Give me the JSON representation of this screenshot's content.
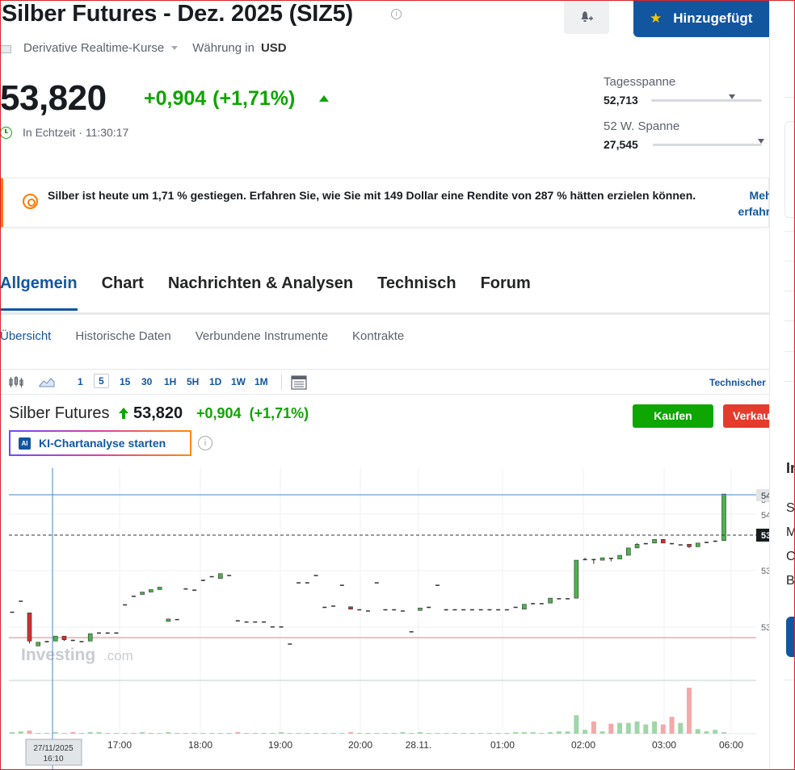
{
  "header": {
    "title": "Silber Futures - Dez. 2025 (SIZ5)",
    "added_label": "Hinzugefügt",
    "source_label": "Derivative Realtime-Kurse",
    "currency_label": "Währung in",
    "currency_value": "USD"
  },
  "quote": {
    "price": "53,820",
    "change": "+0,904",
    "change_pct": "(+1,71%)",
    "realtime_label": "In Echtzeit",
    "time": "11:30:17",
    "day_range_label": "Tagesspanne",
    "day_range_low": "52,713",
    "week52_range_label": "52 W. Spanne",
    "week52_low": "27,545"
  },
  "banner": {
    "text": "Silber ist heute um 1,71 % gestiegen. Erfahren Sie, wie Sie mit 149 Dollar eine Rendite von 287 % hätten erzielen können.",
    "link_line1": "Mehr",
    "link_line2": "erfahre"
  },
  "tabs": [
    "Allgemein",
    "Chart",
    "Nachrichten & Analysen",
    "Technisch",
    "Forum"
  ],
  "subtabs": [
    "Übersicht",
    "Historische Daten",
    "Verbundene Instrumente",
    "Kontrakte"
  ],
  "toolbar": {
    "timeframes": [
      "1",
      "5",
      "15",
      "30",
      "1H",
      "5H",
      "1D",
      "1W",
      "1M"
    ],
    "selected": "5",
    "tech_link": "Technischer"
  },
  "chart_header": {
    "name": "Silber Futures",
    "price": "53,820",
    "change": "+0,904",
    "change_pct": "(+1,71%)",
    "buy_label": "Kaufen",
    "sell_label": "Verkau",
    "ai_label": "KI-Chartanalyse starten",
    "ai_badge": "AI"
  },
  "chart_data": {
    "type": "candlestick",
    "watermark": "Investing",
    "watermark_suffix": ".com",
    "x_tick_labels": [
      "17:00",
      "18:00",
      "19:00",
      "20:00",
      "28.11.",
      "01:00",
      "02:00",
      "03:00",
      "06:00"
    ],
    "crosshair_label_date": "27/11/2025",
    "crosshair_label_time": "16:10",
    "y_tick_labels": [
      "54",
      "54",
      "53",
      "53",
      "53"
    ],
    "last_price_label": "53",
    "candles": [
      [
        52.86,
        52.86,
        52.86,
        52.86
      ],
      [
        52.95,
        52.95,
        52.95,
        52.95
      ],
      [
        52.85,
        52.62,
        52.85,
        52.6
      ],
      [
        52.58,
        52.61,
        52.61,
        52.58
      ],
      [
        52.61,
        52.62,
        52.62,
        52.61
      ],
      [
        52.62,
        52.66,
        52.66,
        52.62
      ],
      [
        52.66,
        52.63,
        52.66,
        52.62
      ],
      [
        52.63,
        52.62,
        52.63,
        52.62
      ],
      [
        52.62,
        52.62,
        52.62,
        52.62
      ],
      [
        52.62,
        52.68,
        52.68,
        52.62
      ],
      [
        52.68,
        52.69,
        52.69,
        52.68
      ],
      [
        52.69,
        52.68,
        52.69,
        52.68
      ],
      [
        52.68,
        52.69,
        52.69,
        52.68
      ],
      [
        52.92,
        52.92,
        52.92,
        52.92
      ],
      [
        52.99,
        52.99,
        52.99,
        52.99
      ],
      [
        53.0,
        53.02,
        53.02,
        53.0
      ],
      [
        53.02,
        53.04,
        53.04,
        53.02
      ],
      [
        53.04,
        53.06,
        53.06,
        53.04
      ],
      [
        52.78,
        52.8,
        52.8,
        52.78
      ],
      [
        52.8,
        52.8,
        52.8,
        52.8
      ],
      [
        53.05,
        53.04,
        53.05,
        53.04
      ],
      [
        53.04,
        53.04,
        53.04,
        53.04
      ],
      [
        53.11,
        53.12,
        53.12,
        53.11
      ],
      [
        53.15,
        53.15,
        53.15,
        53.15
      ],
      [
        53.13,
        53.17,
        53.17,
        53.13
      ],
      [
        53.16,
        53.16,
        53.16,
        53.16
      ],
      [
        52.79,
        52.78,
        52.79,
        52.78
      ],
      [
        52.78,
        52.78,
        52.78,
        52.78
      ],
      [
        52.78,
        52.78,
        52.78,
        52.78
      ],
      [
        52.78,
        52.78,
        52.78,
        52.78
      ],
      [
        52.74,
        52.74,
        52.74,
        52.74
      ],
      [
        52.74,
        52.74,
        52.74,
        52.74
      ],
      [
        52.6,
        52.6,
        52.6,
        52.6
      ],
      [
        53.1,
        53.1,
        53.1,
        53.1
      ],
      [
        53.1,
        53.1,
        53.1,
        53.1
      ],
      [
        53.16,
        53.16,
        53.16,
        53.16
      ],
      [
        52.9,
        52.9,
        52.9,
        52.9
      ],
      [
        52.91,
        52.91,
        52.91,
        52.91
      ],
      [
        53.08,
        53.08,
        53.08,
        53.08
      ],
      [
        52.9,
        52.88,
        52.9,
        52.88
      ],
      [
        52.88,
        52.88,
        52.88,
        52.88
      ],
      [
        52.87,
        52.87,
        52.87,
        52.87
      ],
      [
        53.1,
        53.1,
        53.1,
        53.1
      ],
      [
        52.88,
        52.88,
        52.88,
        52.88
      ],
      [
        52.88,
        52.88,
        52.88,
        52.88
      ],
      [
        52.87,
        52.87,
        52.87,
        52.87
      ],
      [
        52.7,
        52.7,
        52.7,
        52.7
      ],
      [
        52.87,
        52.89,
        52.89,
        52.87
      ],
      [
        52.89,
        52.9,
        52.9,
        52.89
      ],
      [
        53.08,
        53.08,
        53.08,
        53.08
      ],
      [
        52.87,
        52.88,
        52.88,
        52.87
      ],
      [
        52.88,
        52.88,
        52.88,
        52.88
      ],
      [
        52.88,
        52.88,
        52.88,
        52.88
      ],
      [
        52.88,
        52.88,
        52.88,
        52.88
      ],
      [
        52.88,
        52.88,
        52.88,
        52.88
      ],
      [
        52.88,
        52.88,
        52.88,
        52.88
      ],
      [
        52.88,
        52.88,
        52.88,
        52.88
      ],
      [
        52.88,
        52.88,
        52.88,
        52.88
      ],
      [
        52.9,
        52.9,
        52.9,
        52.9
      ],
      [
        52.88,
        52.92,
        52.92,
        52.88
      ],
      [
        52.92,
        52.93,
        52.93,
        52.92
      ],
      [
        52.93,
        52.93,
        52.93,
        52.93
      ],
      [
        52.93,
        52.97,
        52.97,
        52.93
      ],
      [
        52.97,
        52.97,
        52.97,
        52.97
      ],
      [
        52.97,
        52.97,
        52.97,
        52.97
      ],
      [
        52.97,
        53.28,
        53.28,
        52.97
      ],
      [
        53.28,
        53.29,
        53.3,
        53.28
      ],
      [
        53.29,
        53.28,
        53.29,
        53.25
      ],
      [
        53.28,
        53.3,
        53.3,
        53.28
      ],
      [
        53.3,
        53.29,
        53.3,
        53.27
      ],
      [
        53.29,
        53.32,
        53.32,
        53.29
      ],
      [
        53.32,
        53.38,
        53.38,
        53.32
      ],
      [
        53.38,
        53.41,
        53.42,
        53.38
      ],
      [
        53.41,
        53.42,
        53.42,
        53.41
      ],
      [
        53.42,
        53.45,
        53.45,
        53.42
      ],
      [
        53.45,
        53.42,
        53.45,
        53.42
      ],
      [
        53.42,
        53.41,
        53.42,
        53.41
      ],
      [
        53.41,
        53.41,
        53.41,
        53.41
      ],
      [
        53.41,
        53.39,
        53.41,
        53.38
      ],
      [
        53.39,
        53.42,
        53.42,
        53.39
      ],
      [
        53.42,
        53.43,
        53.43,
        53.42
      ],
      [
        53.43,
        53.44,
        53.44,
        53.43
      ],
      [
        53.44,
        53.82,
        53.82,
        53.44
      ]
    ],
    "volumes": [
      2,
      3,
      4,
      1,
      1,
      2,
      1,
      2,
      1,
      2,
      2,
      1,
      1,
      1,
      1,
      2,
      1,
      1,
      2,
      1,
      1,
      1,
      1,
      1,
      1,
      1,
      2,
      1,
      1,
      1,
      1,
      2,
      1,
      1,
      1,
      1,
      1,
      1,
      1,
      2,
      1,
      1,
      1,
      1,
      1,
      2,
      1,
      2,
      1,
      1,
      1,
      1,
      1,
      1,
      1,
      1,
      1,
      1,
      2,
      2,
      2,
      1,
      2,
      3,
      3,
      24,
      5,
      16,
      3,
      13,
      14,
      14,
      16,
      12,
      16,
      12,
      22,
      14,
      60,
      6,
      3,
      5,
      2
    ],
    "ylim": [
      52.45,
      53.9
    ],
    "colors": {
      "up": "#4bb34b",
      "down": "#d12f2f",
      "price_line": "#0a5a9c"
    }
  },
  "rail": {
    "heading": "Ir",
    "lines": [
      "S",
      "M",
      "C",
      "B"
    ]
  }
}
